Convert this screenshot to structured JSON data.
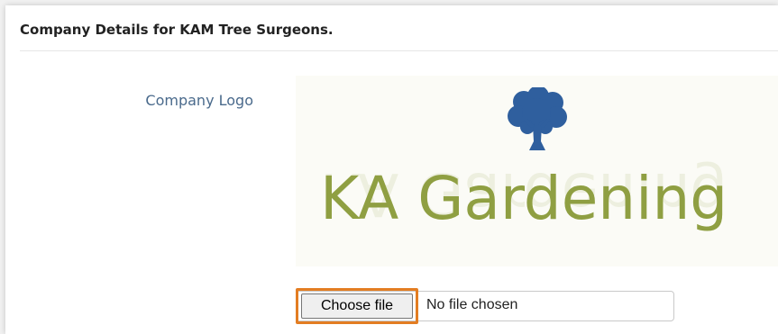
{
  "header": {
    "title": "Company Details for KAM Tree Surgeons."
  },
  "logo": {
    "label": "Company Logo",
    "text": "KA Gardening",
    "tree_color": "#2f5f9e",
    "text_color": "#8f9f42"
  },
  "file_input": {
    "button_label": "Choose file",
    "status": "No file chosen",
    "highlight_color": "#e37d22"
  }
}
